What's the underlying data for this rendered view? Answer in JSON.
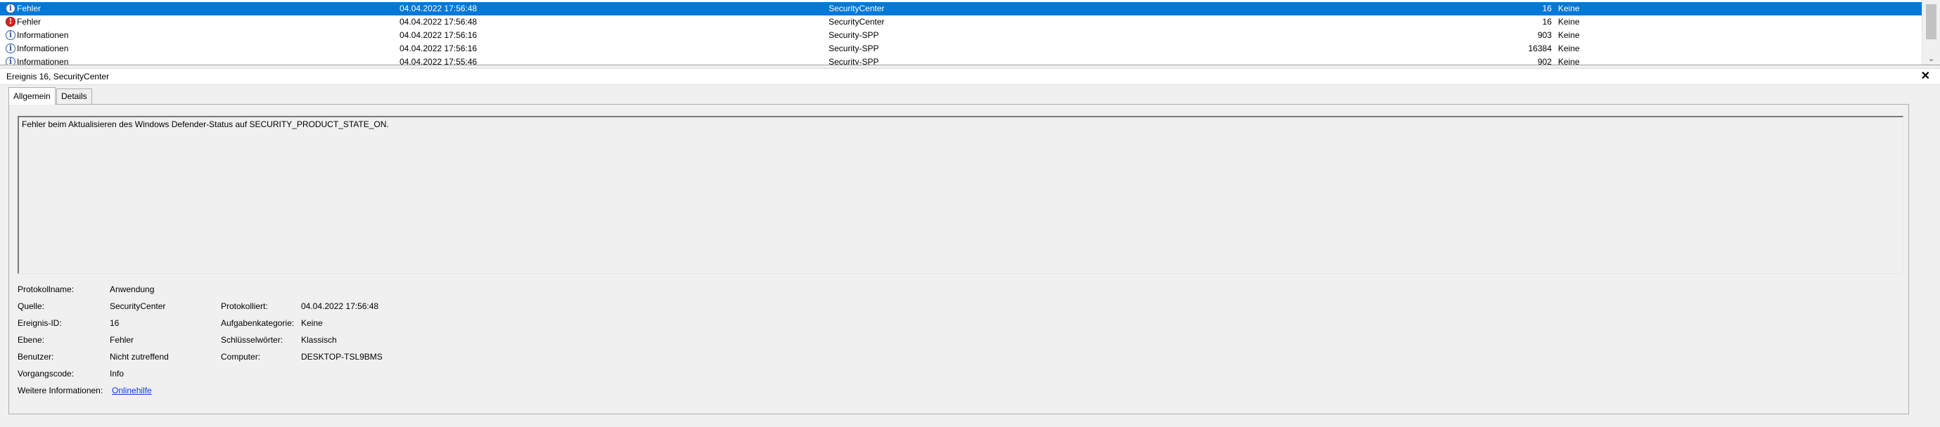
{
  "event_list": {
    "rows": [
      {
        "level": "Fehler",
        "date": "04.04.2022 17:56:48",
        "source": "SecurityCenter",
        "event_id": "16",
        "category": "Keine"
      },
      {
        "level": "Fehler",
        "date": "04.04.2022 17:56:48",
        "source": "SecurityCenter",
        "event_id": "16",
        "category": "Keine"
      },
      {
        "level": "Informationen",
        "date": "04.04.2022 17:56:16",
        "source": "Security-SPP",
        "event_id": "903",
        "category": "Keine"
      },
      {
        "level": "Informationen",
        "date": "04.04.2022 17:56:16",
        "source": "Security-SPP",
        "event_id": "16384",
        "category": "Keine"
      },
      {
        "level": "Informationen",
        "date": "04.04.2022 17:55:46",
        "source": "Security-SPP",
        "event_id": "902",
        "category": "Keine"
      }
    ]
  },
  "detail": {
    "title": "Ereignis 16, SecurityCenter",
    "close_glyph": "✕",
    "tabs": {
      "general": "Allgemein",
      "details": "Details"
    },
    "message": "Fehler beim Aktualisieren des Windows Defender-Status auf SECURITY_PRODUCT_STATE_ON.",
    "labels": {
      "log_name": "Protokollname:",
      "source": "Quelle:",
      "event_id": "Ereignis-ID:",
      "level": "Ebene:",
      "user": "Benutzer:",
      "opcode": "Vorgangscode:",
      "more_info": "Weitere Informationen:",
      "logged": "Protokolliert:",
      "task_category": "Aufgabenkategorie:",
      "keywords": "Schlüsselwörter:",
      "computer": "Computer:"
    },
    "values": {
      "log_name": "Anwendung",
      "source": "SecurityCenter",
      "event_id": "16",
      "level": "Fehler",
      "user": "Nicht zutreffend",
      "opcode": "Info",
      "more_info": "Onlinehilfe",
      "logged": "04.04.2022 17:56:48",
      "task_category": "Keine",
      "keywords": "Klassisch",
      "computer": "DESKTOP-TSL9BMS"
    }
  },
  "icons": {
    "error": "error-icon",
    "info": "info-icon",
    "scroll_down": "chevron-down-icon",
    "close": "close-icon"
  },
  "colors": {
    "selection": "#0078d7",
    "link": "#0b37f0",
    "error": "#d32626"
  }
}
